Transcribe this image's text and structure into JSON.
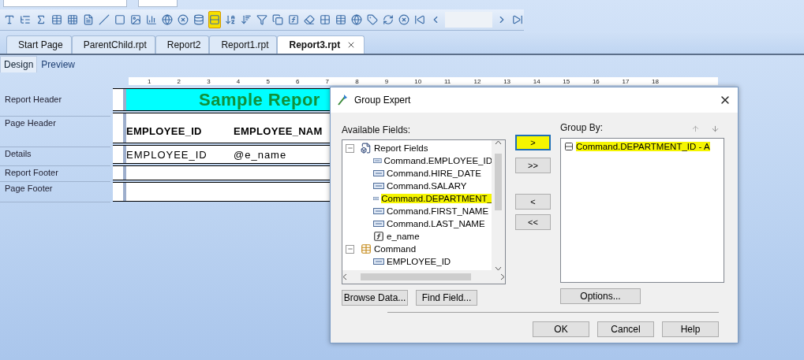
{
  "toolbar": [
    {
      "kind": "text-object",
      "selected": false
    },
    {
      "kind": "group",
      "selected": false
    },
    {
      "kind": "sum",
      "selected": false
    },
    {
      "kind": "cross-tab",
      "selected": false
    },
    {
      "kind": "olap",
      "selected": false
    },
    {
      "kind": "subreport",
      "selected": false
    },
    {
      "kind": "line",
      "selected": false
    },
    {
      "kind": "box",
      "selected": false
    },
    {
      "kind": "picture",
      "selected": false
    },
    {
      "kind": "chart",
      "selected": false
    },
    {
      "kind": "map",
      "selected": false
    },
    {
      "kind": "flash",
      "selected": false
    },
    {
      "kind": "database",
      "selected": false
    },
    {
      "kind": "group-expert",
      "selected": true
    },
    {
      "kind": "sort-record",
      "selected": false
    },
    {
      "kind": "sort-group",
      "selected": false
    },
    {
      "kind": "filter",
      "selected": false
    },
    {
      "kind": "section",
      "selected": false
    },
    {
      "kind": "formula",
      "selected": false
    },
    {
      "kind": "eraser",
      "selected": false
    },
    {
      "kind": "grid",
      "selected": false
    },
    {
      "kind": "table",
      "selected": false
    },
    {
      "kind": "globe",
      "selected": false
    },
    {
      "kind": "tag",
      "selected": false
    },
    {
      "kind": "refresh",
      "selected": false
    },
    {
      "kind": "stop",
      "selected": false
    },
    {
      "kind": "first",
      "selected": false
    },
    {
      "kind": "prev",
      "selected": false
    },
    {
      "kind": "next",
      "selected": false
    },
    {
      "kind": "last",
      "selected": false
    }
  ],
  "tabs": [
    {
      "label": "Start Page",
      "selected": false
    },
    {
      "label": "ParentChild.rpt",
      "selected": false
    },
    {
      "label": "Report2",
      "selected": false
    },
    {
      "label": "Report1.rpt",
      "selected": false
    },
    {
      "label": "Report3.rpt",
      "selected": true
    }
  ],
  "view_tabs": [
    {
      "label": "Design",
      "selected": true
    },
    {
      "label": "Preview",
      "selected": false
    }
  ],
  "ruler": [
    "1",
    "2",
    "3",
    "4",
    "5",
    "6",
    "7",
    "8",
    "9",
    "10",
    "11",
    "12",
    "13",
    "14",
    "15",
    "16",
    "17",
    "18"
  ],
  "sections": [
    {
      "kind": "report-header",
      "label": "Report Header",
      "fields": [
        {
          "text": "Sample Repor"
        }
      ]
    },
    {
      "kind": "page-header",
      "label": "Page Header",
      "fields": [
        {
          "text": "EMPLOYEE_ID"
        },
        {
          "text": "EMPLOYEE_NAM"
        }
      ]
    },
    {
      "kind": "details",
      "label": "Details",
      "fields": [
        {
          "text": "EMPLOYEE_ID"
        },
        {
          "text": "@e_name"
        }
      ]
    },
    {
      "kind": "report-footer",
      "label": "Report Footer"
    },
    {
      "kind": "page-footer",
      "label": "Page Footer"
    }
  ],
  "dialog": {
    "title": "Group Expert",
    "available_label": "Available Fields:",
    "tree": [
      {
        "label": "Report Fields",
        "kind": "folder",
        "expanded": true,
        "selected": false,
        "children": [
          {
            "label": "Command.EMPLOYEE_ID",
            "kind": "field",
            "selected": false
          },
          {
            "label": "Command.HIRE_DATE",
            "kind": "field",
            "selected": false
          },
          {
            "label": "Command.SALARY",
            "kind": "field",
            "selected": false
          },
          {
            "label": "Command.DEPARTMENT_",
            "kind": "field",
            "selected": true
          },
          {
            "label": "Command.FIRST_NAME",
            "kind": "field",
            "selected": false
          },
          {
            "label": "Command.LAST_NAME",
            "kind": "field",
            "selected": false
          },
          {
            "label": "e_name",
            "kind": "formula",
            "selected": false
          }
        ]
      },
      {
        "label": "Command",
        "kind": "table",
        "expanded": true,
        "selected": false,
        "children": [
          {
            "label": "EMPLOYEE_ID",
            "kind": "field",
            "selected": false
          }
        ]
      }
    ],
    "move_buttons": [
      {
        "label": ">",
        "focused": true
      },
      {
        "label": ">>",
        "focused": false
      },
      {
        "label": "<",
        "focused": false
      },
      {
        "label": "<<",
        "focused": false
      }
    ],
    "group_by_label": "Group By:",
    "group_by": [
      {
        "label": "Command.DEPARTMENT_ID - A",
        "selected": true
      }
    ],
    "left_buttons": [
      "Browse Data...",
      "Find Field..."
    ],
    "options_button": "Options...",
    "footer_buttons": [
      "OK",
      "Cancel",
      "Help"
    ]
  }
}
